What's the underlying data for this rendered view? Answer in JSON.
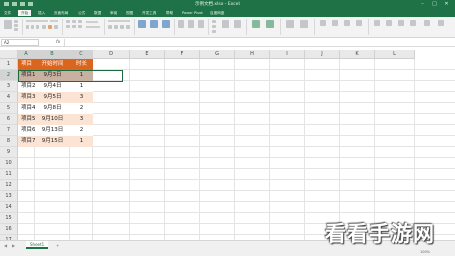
{
  "window": {
    "title": "示例文档.xlsx - Excel"
  },
  "ribbon": {
    "tabs": [
      "文件",
      "开始",
      "插入",
      "页面布局",
      "公式",
      "数据",
      "审阅",
      "视图",
      "开发工具",
      "帮助",
      "Power Pivot",
      "百度网盘"
    ],
    "active_tab": "开始"
  },
  "formula_bar": {
    "name_box": "A2",
    "fx_label": "fx",
    "content": ""
  },
  "grid": {
    "columns": [
      "A",
      "B",
      "C",
      "D",
      "E",
      "F",
      "G",
      "H",
      "I",
      "J",
      "K",
      "L"
    ],
    "rows": [
      "1",
      "2",
      "3",
      "4",
      "5",
      "6",
      "7",
      "8",
      "9",
      "10",
      "11",
      "12",
      "13",
      "14",
      "15",
      "16",
      "17"
    ],
    "selected_row": "2",
    "table": {
      "headers": [
        "项目",
        "开始时间",
        "时长"
      ],
      "rows": [
        [
          "项目1",
          "9月3日",
          "1"
        ],
        [
          "项目2",
          "9月4日",
          "1"
        ],
        [
          "项目3",
          "9月5日",
          "3"
        ],
        [
          "项目4",
          "9月8日",
          "2"
        ],
        [
          "项目5",
          "9月10日",
          "3"
        ],
        [
          "项目6",
          "9月13日",
          "2"
        ],
        [
          "项目7",
          "9月15日",
          "1"
        ]
      ]
    }
  },
  "sheet_tabs": {
    "active": "Sheet1"
  },
  "status": {
    "zoom": "100%"
  },
  "watermark": "看看手游网",
  "colors": {
    "excel_green": "#1f7246",
    "header_fill": "#d9651e",
    "band_fill": "#fbe4d4"
  }
}
